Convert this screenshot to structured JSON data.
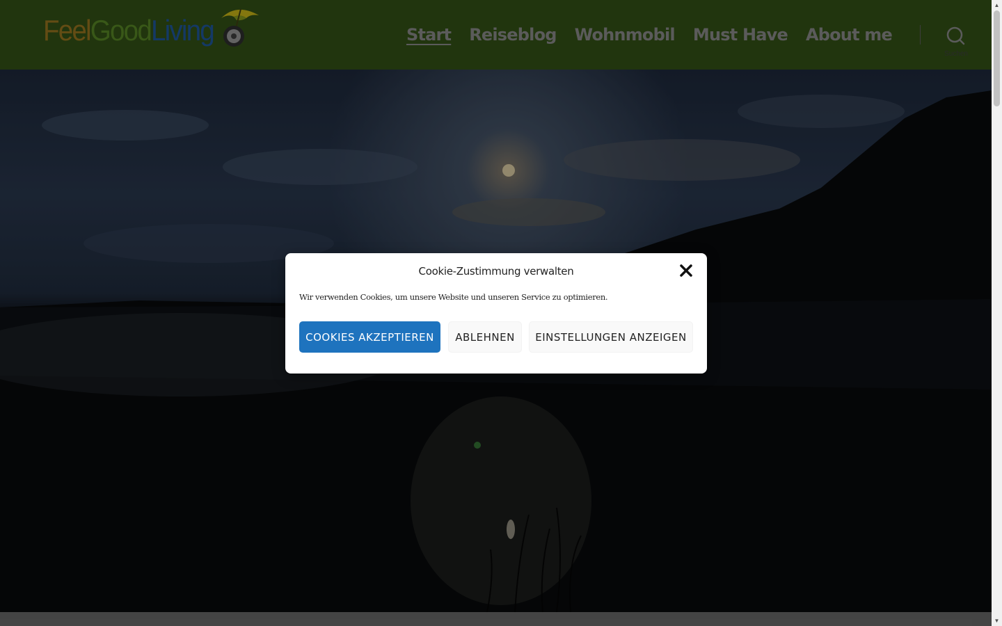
{
  "header": {
    "logo": {
      "parts": [
        "Feel",
        "Good",
        "Living"
      ]
    },
    "nav": [
      {
        "label": "Start",
        "active": true
      },
      {
        "label": "Reiseblog"
      },
      {
        "label": "Wohnmobil"
      },
      {
        "label": "Must Have"
      },
      {
        "label": "About me"
      }
    ],
    "search_label": "Suchen"
  },
  "cookie_dialog": {
    "title": "Cookie-Zustimmung verwalten",
    "text": "Wir verwenden Cookies, um unsere Website und unseren Service zu optimieren.",
    "accept_label": "COOKIES AKZEPTIEREN",
    "deny_label": "ABLEHNEN",
    "settings_label": "EINSTELLUNGEN ANZEIGEN"
  },
  "colors": {
    "header_bg": "#2e4a14",
    "accept_button": "#1e73be",
    "nav_text": "#7f7f7f"
  },
  "icons": {
    "search": "search-icon",
    "close": "close-icon",
    "logo_mark": "umbrella-wheel-icon"
  }
}
